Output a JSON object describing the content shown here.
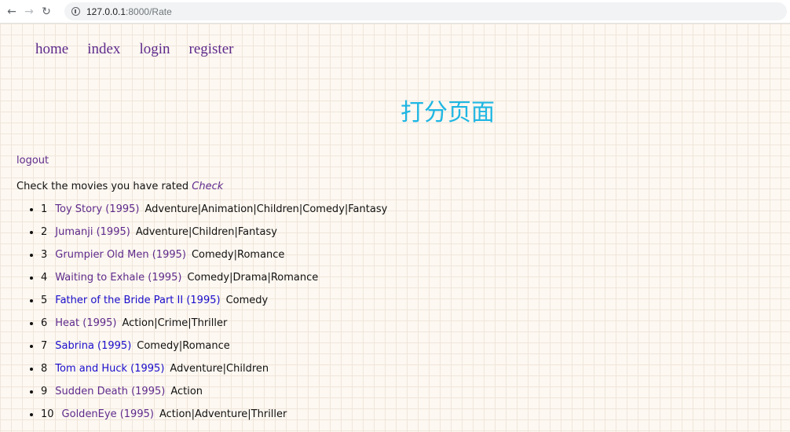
{
  "browser": {
    "back_icon": "←",
    "forward_icon": "→",
    "reload_icon": "↻",
    "url_host": "127.0.0.1",
    "url_rest": ":8000/Rate"
  },
  "nav": [
    {
      "label": "home"
    },
    {
      "label": "index"
    },
    {
      "label": "login"
    },
    {
      "label": "register"
    }
  ],
  "page_title": "打分页面",
  "logout_label": "logout",
  "check": {
    "text": "Check the movies you have rated ",
    "link": "Check"
  },
  "movies": [
    {
      "num": "1",
      "title": "Toy Story (1995)",
      "genres": "Adventure|Animation|Children|Comedy|Fantasy",
      "visited": true
    },
    {
      "num": "2",
      "title": "Jumanji (1995)",
      "genres": "Adventure|Children|Fantasy",
      "visited": true
    },
    {
      "num": "3",
      "title": "Grumpier Old Men (1995)",
      "genres": "Comedy|Romance",
      "visited": true
    },
    {
      "num": "4",
      "title": "Waiting to Exhale (1995)",
      "genres": "Comedy|Drama|Romance",
      "visited": true
    },
    {
      "num": "5",
      "title": "Father of the Bride Part II (1995)",
      "genres": "Comedy",
      "visited": false
    },
    {
      "num": "6",
      "title": "Heat (1995)",
      "genres": "Action|Crime|Thriller",
      "visited": true
    },
    {
      "num": "7",
      "title": "Sabrina (1995)",
      "genres": "Comedy|Romance",
      "visited": false
    },
    {
      "num": "8",
      "title": "Tom and Huck (1995)",
      "genres": "Adventure|Children",
      "visited": false
    },
    {
      "num": "9",
      "title": "Sudden Death (1995)",
      "genres": "Action",
      "visited": true
    },
    {
      "num": "10",
      "title": "GoldenEye (1995)",
      "genres": "Action|Adventure|Thriller",
      "visited": true
    }
  ],
  "colors": {
    "title": "#1fb6e3",
    "visited_link": "#5e2a8c",
    "unvisited_link": "#1a0dcc"
  }
}
